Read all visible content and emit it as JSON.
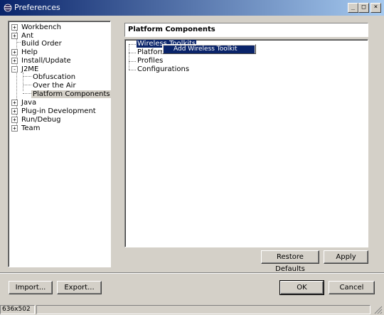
{
  "window": {
    "title": "Preferences",
    "minimize": "_",
    "maximize": "□",
    "close": "×"
  },
  "tree": [
    {
      "label": "Workbench",
      "expander": "+"
    },
    {
      "label": "Ant",
      "expander": "+"
    },
    {
      "label": "Build Order",
      "expander": ""
    },
    {
      "label": "Help",
      "expander": "+"
    },
    {
      "label": "Install/Update",
      "expander": "+"
    },
    {
      "label": "J2ME",
      "expander": "-"
    },
    {
      "label": "Obfuscation",
      "expander": ""
    },
    {
      "label": "Over the Air",
      "expander": ""
    },
    {
      "label": "Platform Components",
      "expander": ""
    },
    {
      "label": "Java",
      "expander": "+"
    },
    {
      "label": "Plug-in Development",
      "expander": "+"
    },
    {
      "label": "Run/Debug",
      "expander": "+"
    },
    {
      "label": "Team",
      "expander": "+"
    }
  ],
  "page": {
    "title": "Platform Components",
    "items": [
      "Wireless Toolkits",
      "Platforms",
      "Profiles",
      "Configurations"
    ]
  },
  "context_menu": {
    "item": "Add Wireless Toolkit"
  },
  "buttons": {
    "restore_defaults": "Restore Defaults",
    "apply": "Apply",
    "import": "Import...",
    "export": "Export...",
    "ok": "OK",
    "cancel": "Cancel"
  },
  "status": {
    "size": "636x502"
  }
}
